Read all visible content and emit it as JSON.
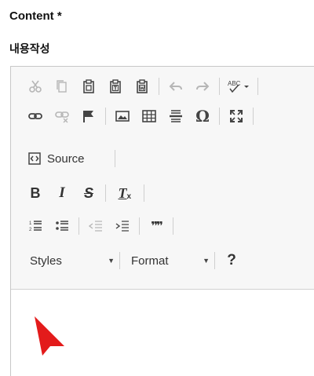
{
  "form": {
    "content_label": "Content *",
    "section_title": "내용작성"
  },
  "toolbar": {
    "row1": [
      {
        "name": "cut-button",
        "icon": "scissors-icon",
        "enabled": false
      },
      {
        "name": "copy-button",
        "icon": "copy-icon",
        "enabled": false
      },
      {
        "name": "paste-button",
        "icon": "clipboard-icon",
        "enabled": true
      },
      {
        "name": "paste-text-button",
        "icon": "clipboard-text-icon",
        "enabled": true
      },
      {
        "name": "paste-word-button",
        "icon": "clipboard-word-icon",
        "enabled": true
      },
      {
        "name": "undo-button",
        "icon": "undo-icon",
        "enabled": false
      },
      {
        "name": "redo-button",
        "icon": "redo-icon",
        "enabled": false
      },
      {
        "name": "spellcheck-button",
        "icon": "spellcheck-icon",
        "label": "ABC",
        "enabled": true
      }
    ],
    "row2": [
      {
        "name": "link-button",
        "icon": "link-icon",
        "enabled": true
      },
      {
        "name": "unlink-button",
        "icon": "unlink-icon",
        "enabled": false
      },
      {
        "name": "anchor-button",
        "icon": "flag-icon",
        "enabled": true
      },
      {
        "name": "image-button",
        "icon": "image-icon",
        "enabled": true
      },
      {
        "name": "table-button",
        "icon": "table-icon",
        "enabled": true
      },
      {
        "name": "horizontal-line-button",
        "icon": "horizontal-line-icon",
        "enabled": true
      },
      {
        "name": "special-char-button",
        "icon": "omega-icon",
        "label": "Ω",
        "enabled": true
      },
      {
        "name": "maximize-button",
        "icon": "maximize-icon",
        "enabled": true
      }
    ],
    "source_label": "Source",
    "format_glyphs": {
      "bold": "B",
      "italic": "I",
      "strike": "S",
      "remove_format": "T"
    },
    "list_glyphs": {
      "blockquote": "❞❞"
    },
    "styles_label": "Styles",
    "format_label": "Format",
    "help_label": "?"
  },
  "colors": {
    "toolbar_bg": "#f7f7f7",
    "border": "#c8c8c8",
    "icon": "#444444",
    "icon_disabled": "#b6b6b6",
    "cursor_red": "#e31b1b"
  }
}
